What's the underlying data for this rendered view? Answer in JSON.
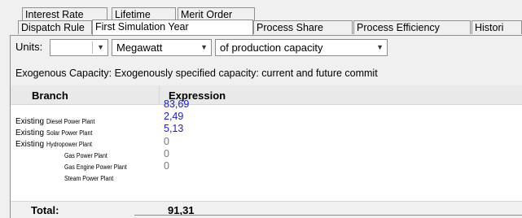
{
  "tabs_row1": [
    "Interest Rate",
    "Lifetime",
    "Merit Order"
  ],
  "tabs_row2": [
    "Dispatch Rule",
    "First Simulation Year",
    "Process Share",
    "Process Efficiency",
    "Histori"
  ],
  "units": {
    "label": "Units:",
    "scale_value": "",
    "unit_value": "Megawatt",
    "per_value": "of production capacity"
  },
  "description": "Exogenous Capacity: Exogenously specified capacity: current and future commit",
  "grid": {
    "headers": {
      "branch": "Branch",
      "expression": "Expression"
    },
    "rows": [
      {
        "prefix": "Existing",
        "name": "Diesel Power Plant",
        "value": "83,69",
        "color": "#1b1bd9"
      },
      {
        "prefix": "Existing",
        "name": "Solar Power Plant",
        "value": "2,49",
        "color": "#1b1bd9"
      },
      {
        "prefix": "Existing",
        "name": "Hydropower Plant",
        "value": "5,13",
        "color": "#1b1bd9"
      },
      {
        "prefix": "",
        "name": "Gas Power Plant",
        "value": "0",
        "color": "#7a7a7a"
      },
      {
        "prefix": "",
        "name": "Gas Engine Power Plant",
        "value": "0",
        "color": "#7a7a7a"
      },
      {
        "prefix": "",
        "name": "Steam Power Plant",
        "value": "0",
        "color": "#7a7a7a"
      }
    ],
    "total_label": "Total:",
    "total_value": "91,31"
  },
  "icons": {
    "combo_arrow": "chevron-down-icon"
  }
}
